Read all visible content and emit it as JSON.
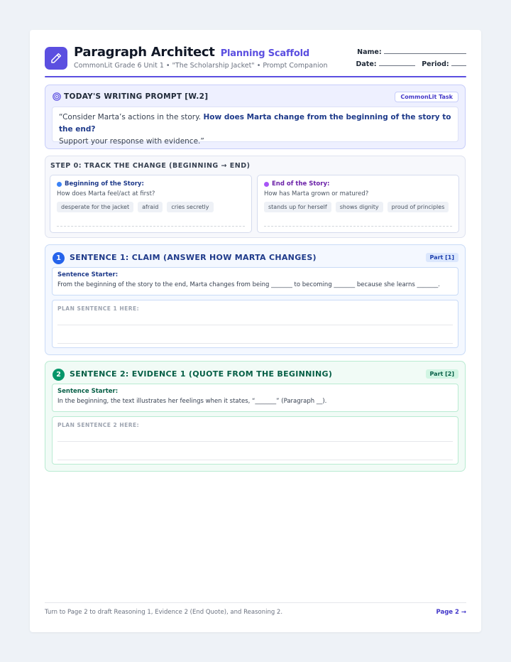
{
  "header": {
    "title": "Paragraph Architect",
    "title_sub": "Planning Scaffold",
    "subtitle": "CommonLit Grade 6 Unit 1 • \"The Scholarship Jacket\" • Prompt Companion",
    "name_label": "Name:",
    "date_label": "Date:",
    "period_label": "Period:"
  },
  "prompt": {
    "title": "TODAY'S WRITING PROMPT [W.2]",
    "tag": "CommonLit Task",
    "text_intro": "“Consider Marta’s actions in the story.",
    "text_bold": "How does Marta change from the beginning of the story to the end?",
    "text_end": "Support your response with evidence.”"
  },
  "step0": {
    "title": "STEP 0: TRACK THE CHANGE (BEGINNING → END)",
    "beginning": {
      "title": "Beginning of the Story:",
      "question": "How does Marta feel/act at first?",
      "chips": [
        "desperate for the jacket",
        "afraid",
        "cries secretly"
      ]
    },
    "end": {
      "title": "End of the Story:",
      "question": "How has Marta grown or matured?",
      "chips": [
        "stands up for herself",
        "shows dignity",
        "proud of principles"
      ]
    }
  },
  "sentence1": {
    "number": "1",
    "title": "SENTENCE 1: CLAIM (ANSWER HOW MARTA CHANGES)",
    "part": "Part [1]",
    "starter_label": "Sentence Starter:",
    "starter_text": "From the beginning of the story to the end, Marta changes from being _______ to becoming _______ because she learns _______.",
    "plan_label": "PLAN SENTENCE 1 HERE:"
  },
  "sentence2": {
    "number": "2",
    "title": "SENTENCE 2: EVIDENCE 1 (QUOTE FROM THE BEGINNING)",
    "part": "Part [2]",
    "starter_label": "Sentence Starter:",
    "starter_text": "In the beginning, the text illustrates her feelings when it states, “_______” (Paragraph __).",
    "plan_label": "PLAN SENTENCE 2 HERE:"
  },
  "footer": {
    "text": "Turn to Page 2 to draft Reasoning 1, Evidence 2 (End Quote), and Reasoning 2.",
    "page_link": "Page 2 →"
  },
  "colors": {
    "accent": "#5b4fe0",
    "blue": "#2563eb",
    "green": "#059669",
    "purple": "#9b4fd6"
  },
  "icons": {
    "logo": "pencil-icon",
    "prompt": "target-icon"
  }
}
